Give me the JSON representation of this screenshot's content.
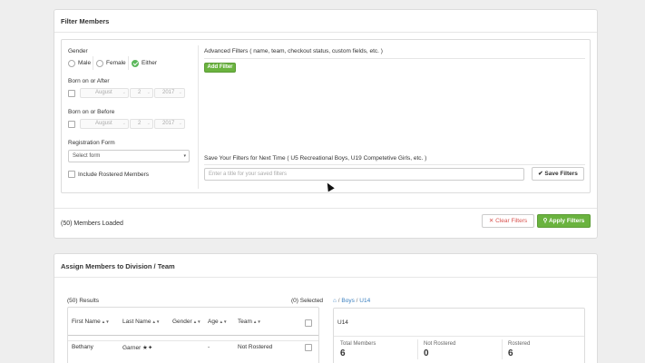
{
  "filter_panel": {
    "title": "Filter Members",
    "gender": {
      "label": "Gender",
      "options": [
        "Male",
        "Female",
        "Either"
      ],
      "selected": "Either"
    },
    "born_after": {
      "label": "Born on or After",
      "month": "August",
      "day": "2",
      "year": "2017"
    },
    "born_before": {
      "label": "Born on or Before",
      "month": "August",
      "day": "2",
      "year": "2017"
    },
    "registration_form": {
      "label": "Registration Form",
      "value": "Select form"
    },
    "include_rostered": "Include Rostered Members",
    "advanced": {
      "title": "Advanced Filters",
      "hint": "( name, team, checkout status, custom fields, etc. )",
      "add_button": "Add Filter"
    },
    "save": {
      "title": "Save Your Filters for Next Time",
      "hint": "( U5 Recreational Boys, U19 Competetive Girls, etc. )",
      "placeholder": "Enter a title for your saved filters",
      "button": "Save Filters"
    },
    "members_loaded": "(50) Members Loaded",
    "clear_button": "Clear Filters",
    "apply_button": "Apply Filters"
  },
  "assign_panel": {
    "title": "Assign Members to Division / Team",
    "results": "(50) Results",
    "selected": "(0) Selected",
    "columns": [
      "First Name",
      "Last Name",
      "Gender",
      "Age",
      "Team"
    ],
    "rows": [
      {
        "first": "Bethany",
        "last": "Garner",
        "gender": "",
        "age": "-",
        "team": "Not Rostered"
      }
    ],
    "breadcrumb": {
      "root_icon": "home-icon",
      "sep": "/",
      "level1": "Boys",
      "level2": "U14"
    },
    "team_card": {
      "title": "U14",
      "stats": [
        {
          "label": "Total Members",
          "value": "6"
        },
        {
          "label": "Not Rostered",
          "value": "0"
        },
        {
          "label": "Rostered",
          "value": "6"
        }
      ]
    }
  },
  "colors": {
    "accent_green": "#6ab33f",
    "danger_red": "#d9534f",
    "link_blue": "#3a7fbf"
  }
}
